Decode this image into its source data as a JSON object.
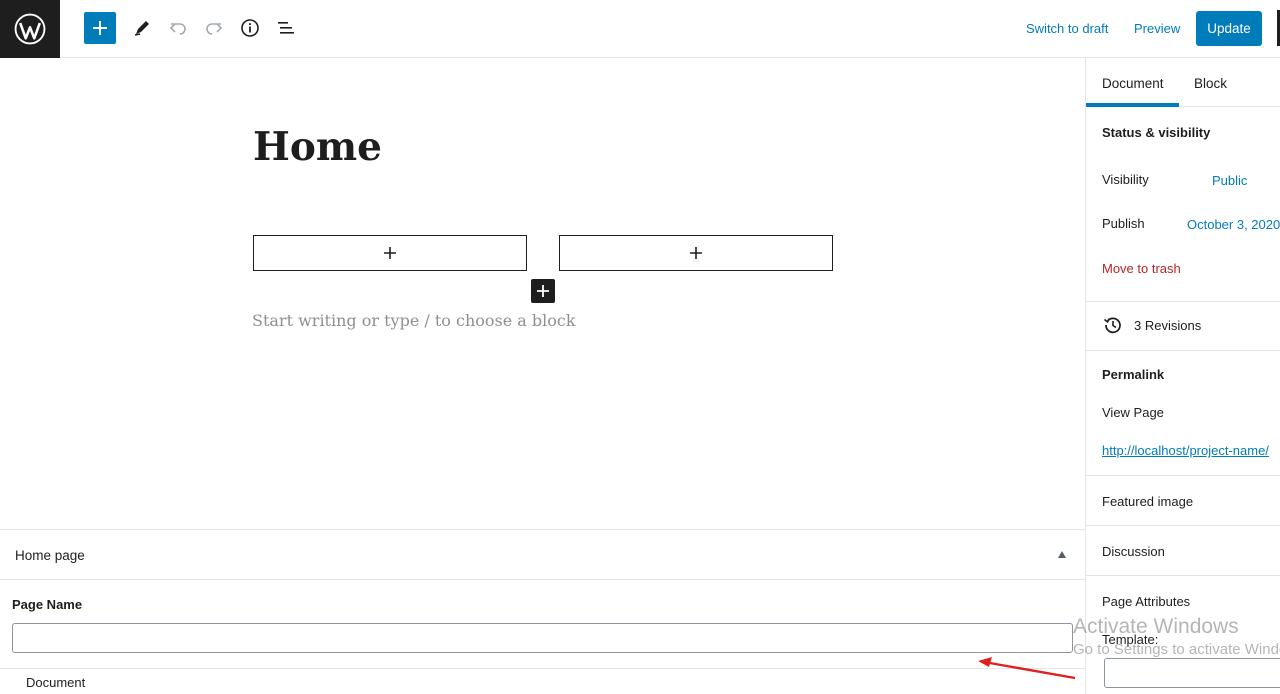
{
  "toolbar": {
    "switch_to_draft": "Switch to draft",
    "preview": "Preview",
    "update": "Update"
  },
  "editor": {
    "title": "Home",
    "placeholder": "Start writing or type / to choose a block"
  },
  "meta_box": {
    "title": "Home page",
    "field_label": "Page Name",
    "field_value": ""
  },
  "footer": {
    "breadcrumb": "Document"
  },
  "sidebar": {
    "tabs": [
      "Document",
      "Block"
    ],
    "status_visibility": "Status & visibility",
    "visibility_label": "Visibility",
    "visibility_value": "Public",
    "publish_label": "Publish",
    "publish_value": "October 3, 2020",
    "move_to_trash": "Move to trash",
    "revisions": "3 Revisions",
    "permalink": "Permalink",
    "view_page": "View Page",
    "url": "http://localhost/project-name/",
    "featured_image": "Featured image",
    "discussion": "Discussion",
    "page_attributes": "Page Attributes",
    "template": "Template:"
  },
  "watermark": {
    "line1": "Activate Windows",
    "line2": "Go to Settings to activate Windows."
  },
  "colors": {
    "accent": "#007cba",
    "dark": "#1e1e1e",
    "trash": "#b52727",
    "annotation_arrow": "#e0201f"
  }
}
